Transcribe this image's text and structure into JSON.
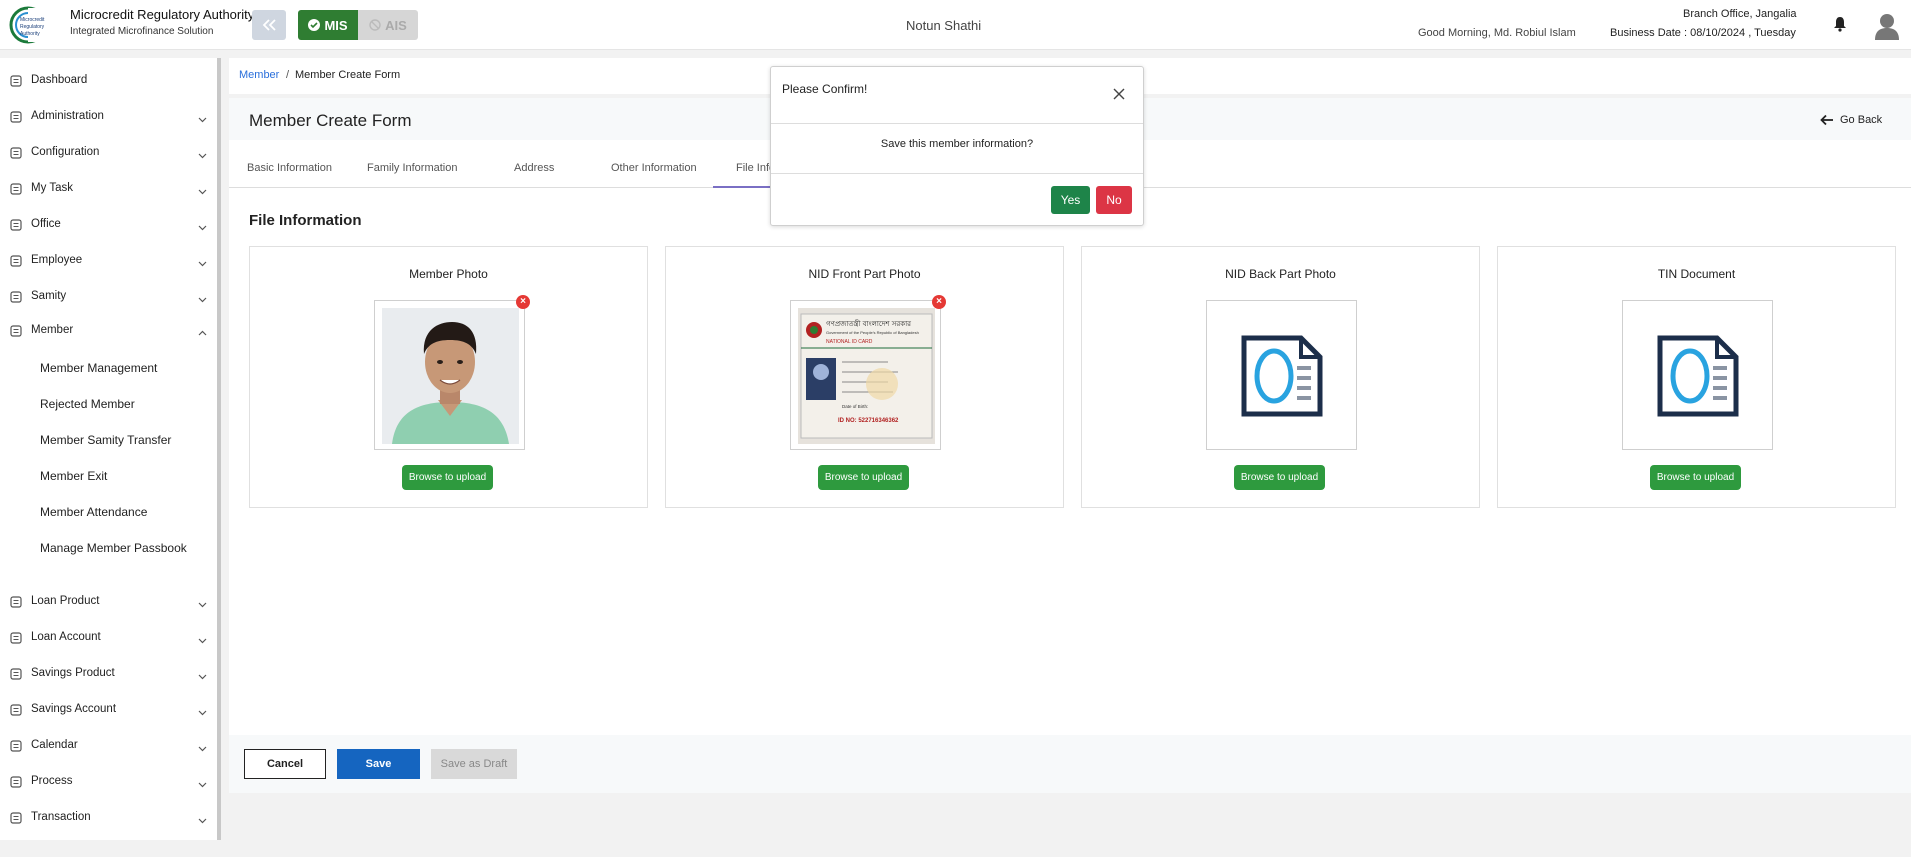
{
  "header": {
    "org_title": "Microcredit Regulatory Authority",
    "org_subtitle": "Integrated Microfinance Solution",
    "mode_mis": "MIS",
    "mode_ais": "AIS",
    "app_name": "Notun Shathi",
    "greeting": "Good Morning, Md. Robiul Islam",
    "branch": "Branch Office, Jangalia",
    "business_date": "Business Date : 08/10/2024 , Tuesday"
  },
  "sidebar": {
    "items": [
      {
        "label": "Dashboard",
        "icon": "dashboard-icon"
      },
      {
        "label": "Administration",
        "icon": "admin-icon"
      },
      {
        "label": "Configuration",
        "icon": "sliders-icon"
      },
      {
        "label": "My Task",
        "icon": "task-icon"
      },
      {
        "label": "Office",
        "icon": "office-icon"
      },
      {
        "label": "Employee",
        "icon": "employee-icon"
      },
      {
        "label": "Samity",
        "icon": "samity-icon"
      },
      {
        "label": "Member",
        "icon": "member-icon"
      },
      {
        "label": "Loan Product",
        "icon": "loan-product-icon"
      },
      {
        "label": "Loan Account",
        "icon": "loan-account-icon"
      },
      {
        "label": "Savings Product",
        "icon": "savings-product-icon"
      },
      {
        "label": "Savings Account",
        "icon": "savings-account-icon"
      },
      {
        "label": "Calendar",
        "icon": "calendar-icon"
      },
      {
        "label": "Process",
        "icon": "process-icon"
      },
      {
        "label": "Transaction",
        "icon": "transaction-icon"
      }
    ],
    "member_sub": [
      "Member Management",
      "Rejected Member",
      "Member Samity Transfer",
      "Member Exit",
      "Member Attendance",
      "Manage Member Passbook"
    ]
  },
  "breadcrumb": {
    "link": "Member",
    "sep": "/",
    "current": "Member Create Form"
  },
  "page": {
    "title": "Member Create Form",
    "go_back": "Go Back"
  },
  "tabs": [
    "Basic Information",
    "Family Information",
    "Address",
    "Other Information",
    "File Infor"
  ],
  "section_title": "File Information",
  "cards": [
    {
      "title": "Member Photo",
      "upload": "Browse to upload"
    },
    {
      "title": "NID Front Part Photo",
      "upload": "Browse to upload"
    },
    {
      "title": "NID Back Part Photo",
      "upload": "Browse to upload"
    },
    {
      "title": "TIN Document",
      "upload": "Browse to upload"
    }
  ],
  "nid_card": {
    "header_bn": "গণপ্রজাতন্ত্রী বাংলাদেশ সরকার",
    "header_en": "Government of the People's Republic of Bangladesh",
    "national_id": "NATIONAL ID CARD",
    "id_no": "ID NO: 522716346362"
  },
  "footer": {
    "cancel": "Cancel",
    "save": "Save",
    "draft": "Save as Draft"
  },
  "modal": {
    "title": "Please Confirm!",
    "message": "Save this member information?",
    "yes": "Yes",
    "no": "No"
  },
  "colors": {
    "primary": "#1565c0",
    "success": "#2e9a3e",
    "danger": "#dc3545",
    "mis_green": "#2f7d32"
  }
}
